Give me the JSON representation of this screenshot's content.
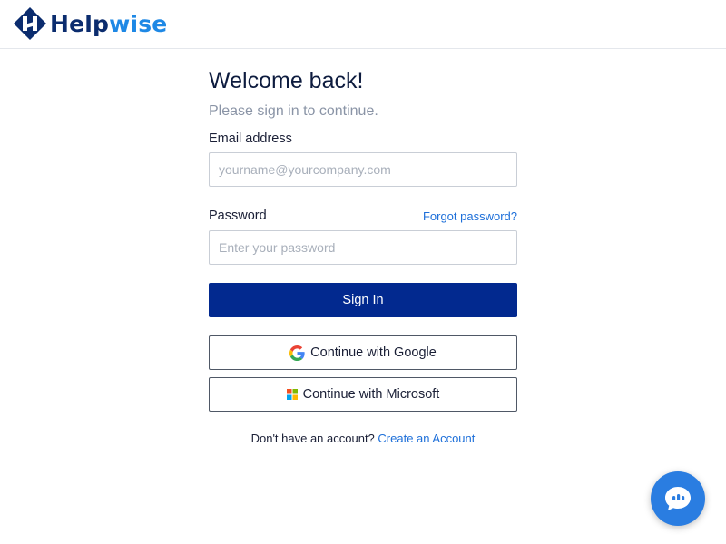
{
  "brand": {
    "name_part1": "Help",
    "name_part2": "wise",
    "logo_icon": "helpwise-logo-icon",
    "colors": {
      "dark": "#0b2c6e",
      "light": "#1e88e5"
    }
  },
  "login": {
    "title": "Welcome back!",
    "subtitle": "Please sign in to continue.",
    "email": {
      "label": "Email address",
      "placeholder": "yourname@yourcompany.com",
      "value": ""
    },
    "password": {
      "label": "Password",
      "placeholder": "Enter your password",
      "value": "",
      "forgot_link": "Forgot password?"
    },
    "sign_in_button": "Sign In",
    "google_button": "Continue with Google",
    "microsoft_button": "Continue with Microsoft",
    "signup_prompt": "Don't have an account?",
    "signup_link": "Create an Account"
  },
  "chat_widget": {
    "icon": "chat-bubble-icon",
    "color": "#2a7de1"
  },
  "colors": {
    "primary_button": "#02298f",
    "link": "#1d6fd9",
    "subtitle": "#8a94a6"
  }
}
